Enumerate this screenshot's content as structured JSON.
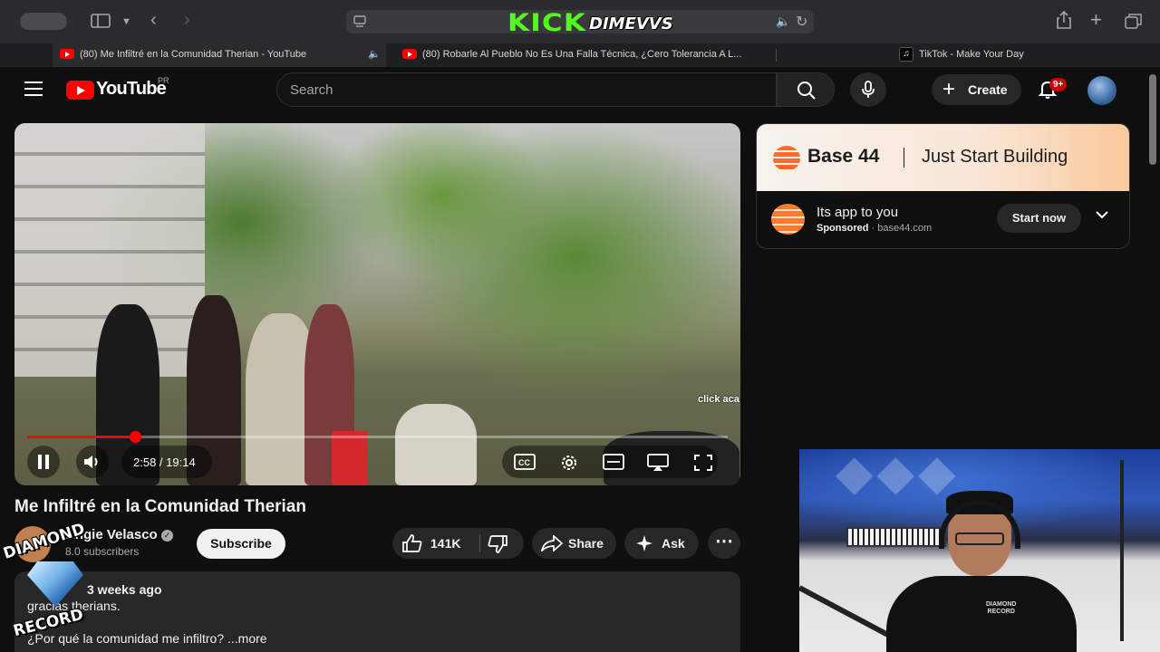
{
  "browser": {
    "kick_logo": "KICK",
    "kick_user": "DIMEVVS",
    "tabs": [
      {
        "title": "(80) Me Infiltré en la Comunidad Therian - YouTube",
        "favicon": "youtube-icon",
        "active": true
      },
      {
        "title": "(80) Robarle Al Pueblo No Es Una Falla Técnica, ¿Cero Tolerancia A L...",
        "favicon": "youtube-icon",
        "active": false
      },
      {
        "title": "TikTok - Make Your Day",
        "favicon": "tiktok-icon",
        "active": false
      }
    ]
  },
  "header": {
    "logo_text": "YouTube",
    "country_code": "PR",
    "search_placeholder": "Search",
    "create_label": "Create",
    "notification_count": "9+"
  },
  "player": {
    "time": "2:58 / 19:14",
    "progress": 0.154,
    "overlay_text": "click aca"
  },
  "video": {
    "title": "Me Infiltré en la Comunidad Therian",
    "channel": "Angie Velasco",
    "subscribers": "8.0 subscribers",
    "subscribe_label": "Subscribe",
    "likes": "141K",
    "share_label": "Share",
    "ask_label": "Ask",
    "upload_meta": "3 weeks ago",
    "desc_line1": "gracias therians.",
    "desc_line2": "¿Por qué la comunidad me infiltro? ...more"
  },
  "ad": {
    "brand": "Base 44",
    "tagline": "Just Start Building",
    "title": "Its app to you",
    "sponsored": "Sponsored",
    "domain": "base44.com",
    "cta": "Start now"
  },
  "overlay": {
    "diamond_top": "DIAMOND",
    "diamond_bottom": "RECORD",
    "shirt_top": "DIAMOND",
    "shirt_bottom": "RECORD"
  },
  "colors": {
    "accent": "#ff0000",
    "kick_green": "#53fc18",
    "background": "#0f0f0f"
  }
}
